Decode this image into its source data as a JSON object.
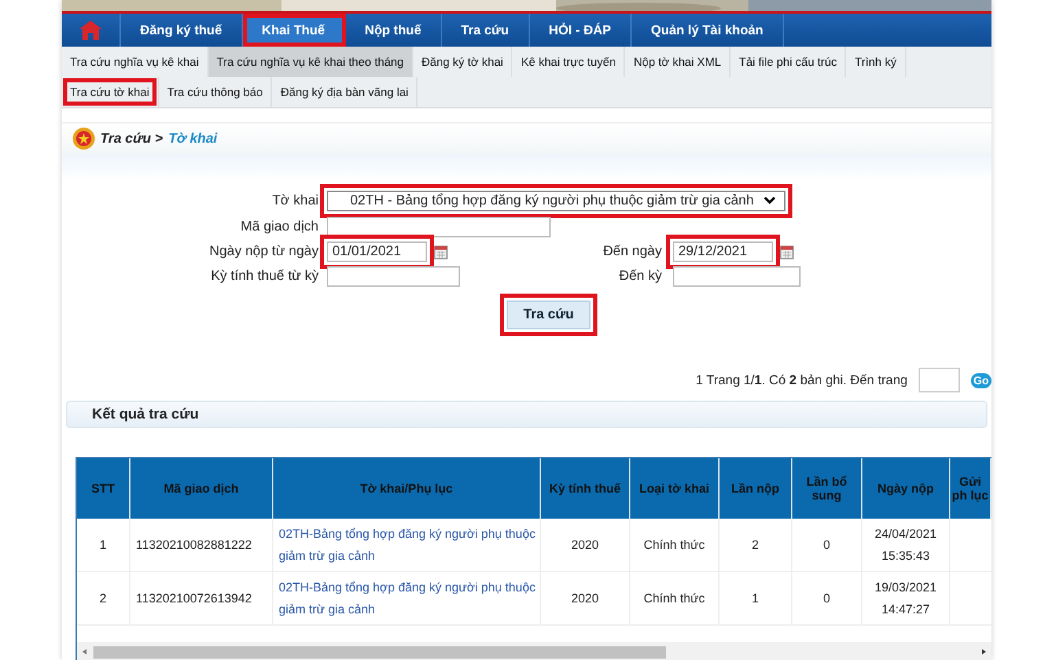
{
  "nav": {
    "items": [
      {
        "label": "Đăng ký thuế",
        "selected": false,
        "highlighted": false
      },
      {
        "label": "Khai Thuế",
        "selected": true,
        "highlighted": true
      },
      {
        "label": "Nộp thuế",
        "selected": false,
        "highlighted": false
      },
      {
        "label": "Tra cứu",
        "selected": false,
        "highlighted": false
      },
      {
        "label": "HỎI - ĐÁP",
        "selected": false,
        "highlighted": false
      },
      {
        "label": "Quản lý Tài khoản",
        "selected": false,
        "highlighted": false
      }
    ]
  },
  "subnav": {
    "items": [
      {
        "label": "Tra cứu nghĩa vụ kê khai",
        "selected": false,
        "highlighted": false
      },
      {
        "label": "Tra cứu nghĩa vụ kê khai theo tháng",
        "selected": true,
        "highlighted": false
      },
      {
        "label": "Đăng ký tờ khai",
        "selected": false,
        "highlighted": false
      },
      {
        "label": "Kê khai trực tuyến",
        "selected": false,
        "highlighted": false
      },
      {
        "label": "Nộp tờ khai XML",
        "selected": false,
        "highlighted": false
      },
      {
        "label": "Tải file phi cấu trúc",
        "selected": false,
        "highlighted": false
      },
      {
        "label": "Trình ký",
        "selected": false,
        "highlighted": false
      },
      {
        "label": "Tra cứu tờ khai",
        "selected": false,
        "highlighted": true
      },
      {
        "label": "Tra cứu thông báo",
        "selected": false,
        "highlighted": false
      },
      {
        "label": "Đăng ký địa bàn vãng lai",
        "selected": false,
        "highlighted": false
      }
    ]
  },
  "breadcrumb": {
    "parent": "Tra cứu >",
    "current": "Tờ khai"
  },
  "form": {
    "to_khai": {
      "label": "Tờ khai",
      "value": "02TH - Bảng tổng hợp đăng ký người phụ thuộc giảm trừ gia cảnh",
      "highlighted": true
    },
    "ma_giao_dich": {
      "label": "Mã giao dịch"
    },
    "ngay_nop_tu": {
      "label": "Ngày nộp từ ngày",
      "value": "01/01/2021",
      "highlighted": true
    },
    "den_ngay": {
      "label": "Đến ngày",
      "value": "29/12/2021",
      "highlighted": true
    },
    "ky_tu": {
      "label": "Kỳ tính thuế từ kỳ"
    },
    "den_ky": {
      "label": "Đến kỳ"
    },
    "button": {
      "label": "Tra cứu",
      "highlighted": true
    }
  },
  "pagination": {
    "text": "1  Trang 1/**1**. Có **2** bản ghi. Đến trang",
    "go": "Go"
  },
  "results": {
    "title": "Kết quả tra cứu",
    "columns": [
      "STT",
      "Mã giao dịch",
      "Tờ khai/Phụ lục",
      "Kỳ tính thuế",
      "Loại tờ khai",
      "Lần nộp",
      "Lần bổ sung",
      "Ngày nộp",
      "Gửi ph lục"
    ],
    "rows": [
      {
        "stt": "1",
        "ma": "11320210082881222",
        "to_khai": "02TH-Bảng tổng hợp đăng ký người phụ thuộc giảm trừ gia cảnh",
        "ky": "2020",
        "loai": "Chính thức",
        "lan_nop": "2",
        "lan_bs": "0",
        "ngay": "24/04/2021",
        "gio": "15:35:43"
      },
      {
        "stt": "2",
        "ma": "11320210072613942",
        "to_khai": "02TH-Bảng tổng hợp đăng ký người phụ thuộc giảm trừ gia cảnh",
        "ky": "2020",
        "loai": "Chính thức",
        "lan_nop": "1",
        "lan_bs": "0",
        "ngay": "19/03/2021",
        "gio": "14:47:27"
      }
    ]
  }
}
